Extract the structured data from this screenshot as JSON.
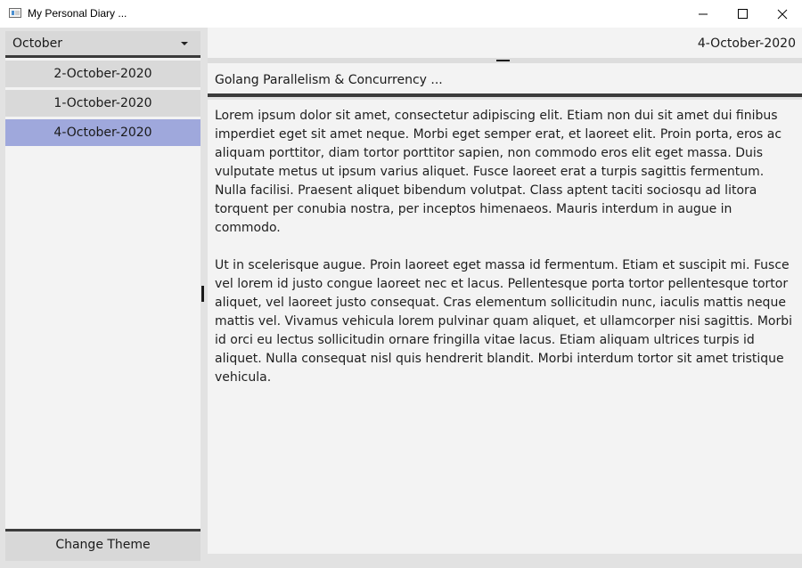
{
  "window": {
    "title": "My Personal Diary ...",
    "app_icon": "app-window-icon",
    "controls": [
      "minimize-icon",
      "maximize-icon",
      "close-icon"
    ]
  },
  "sidebar": {
    "month_select": {
      "value": "October",
      "icon": "chevron-down-icon"
    },
    "entries": [
      {
        "label": "2-October-2020",
        "selected": false
      },
      {
        "label": "1-October-2020",
        "selected": false
      },
      {
        "label": "4-October-2020",
        "selected": true
      }
    ],
    "theme_button": "Change Theme"
  },
  "main": {
    "date": "4-October-2020",
    "entry_title": "Golang Parallelism & Concurrency ...",
    "paragraphs": [
      "Lorem ipsum dolor sit amet, consectetur adipiscing elit. Etiam non dui sit amet dui finibus imperdiet eget sit amet neque. Morbi eget semper erat, et laoreet elit. Proin porta, eros ac aliquam porttitor, diam tortor porttitor sapien, non commodo eros elit eget massa. Duis vulputate metus ut ipsum varius aliquet. Fusce laoreet erat a turpis sagittis fermentum. Nulla facilisi. Praesent aliquet bibendum volutpat. Class aptent taciti sociosqu ad litora torquent per conubia nostra, per inceptos himenaeos. Mauris interdum in augue in commodo.",
      "Ut in scelerisque augue. Proin laoreet eget massa id fermentum. Etiam et suscipit mi. Fusce vel lorem id justo congue laoreet nec et lacus. Pellentesque porta tortor pellentesque tortor aliquet, vel laoreet justo consequat. Cras elementum sollicitudin nunc, iaculis mattis neque mattis vel. Vivamus vehicula lorem pulvinar quam aliquet, et ullamcorper nisi sagittis. Morbi id orci eu lectus sollicitudin ornare fringilla vitae lacus. Etiam aliquam ultrices turpis id aliquet. Nulla consequat nisl quis hendrerit blandit. Morbi interdum tortor sit amet tristique vehicula."
    ]
  },
  "colors": {
    "selected_entry": "#9fa8dc",
    "button_bg": "#d8d8d8",
    "separator": "#3b3b3b",
    "pane_bg": "#f3f3f3"
  }
}
